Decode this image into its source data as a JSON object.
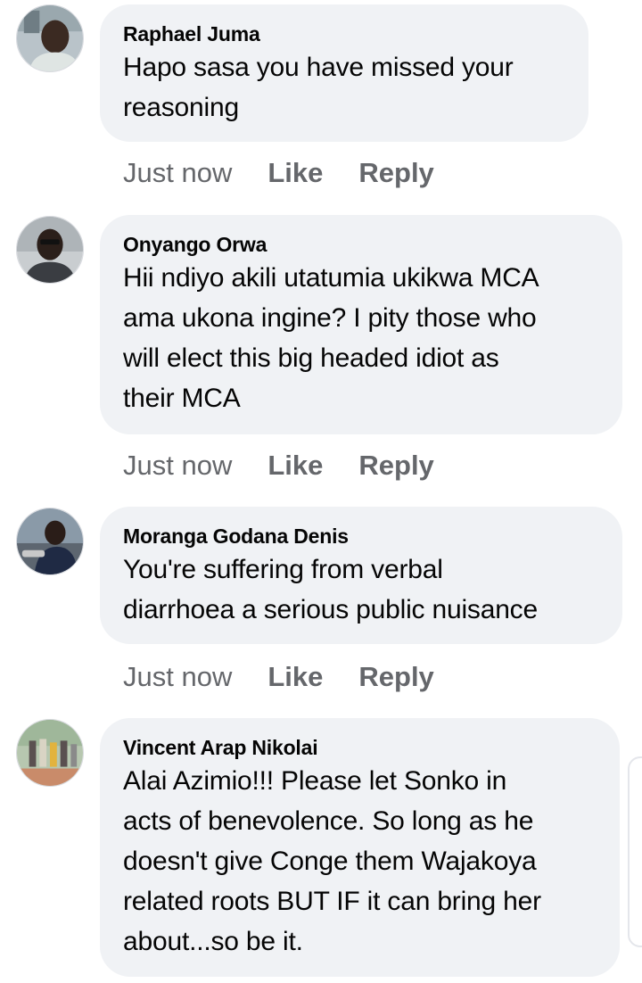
{
  "comments": [
    {
      "author": "Raphael Juma",
      "text": "Hapo sasa you have missed your\nreasoning",
      "time": "Just now",
      "like": "Like",
      "reply": "Reply"
    },
    {
      "author": "Onyango Orwa",
      "text": "Hii ndiyo akili utatumia ukikwa MCA\nama ukona ingine? I pity those who\nwill elect this big headed idiot as\ntheir MCA",
      "time": "Just now",
      "like": "Like",
      "reply": "Reply"
    },
    {
      "author": "Moranga Godana Denis",
      "text": "You're suffering from verbal\ndiarrhoea a serious public nuisance",
      "time": "Just now",
      "like": "Like",
      "reply": "Reply"
    },
    {
      "author": "Vincent Arap Nikolai",
      "text": "Alai Azimio!!! Please let Sonko in\nacts of benevolence. So long as he\ndoesn't give Conge them Wajakoya\nrelated roots BUT IF it can bring her\nabout...so be it."
    }
  ],
  "colors": {
    "bubble": "#f0f2f5",
    "meta_text": "#65676b",
    "body_text": "#050505"
  }
}
